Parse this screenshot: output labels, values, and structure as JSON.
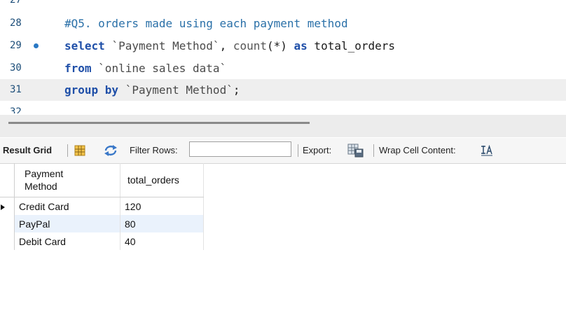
{
  "editor": {
    "lines": [
      {
        "num": "27",
        "text": ""
      },
      {
        "num": "28",
        "text": "#Q5. orders made using each payment method"
      },
      {
        "num": "29",
        "kw1": "select",
        "sp1": " ",
        "str1": "`Payment Method`",
        "sp2": ", ",
        "fn1": "count",
        "sp3": "(*) ",
        "kw2": "as",
        "sp4": " total_orders"
      },
      {
        "num": "30",
        "kw1": "from",
        "sp1": " ",
        "str1": "`online sales data`"
      },
      {
        "num": "31",
        "kw1": "group by",
        "sp1": " ",
        "str1": "`Payment Method`",
        "sp2": ";"
      },
      {
        "num": "32",
        "text": ""
      }
    ]
  },
  "toolbar": {
    "result_grid_label": "Result Grid",
    "filter_rows_label": "Filter Rows:",
    "filter_value": "",
    "export_label": "Export:",
    "wrap_label": "Wrap Cell Content:"
  },
  "grid": {
    "headers": [
      "Payment\nMethod",
      "total_orders"
    ],
    "rows": [
      [
        "Credit Card",
        "120"
      ],
      [
        "PayPal",
        "80"
      ],
      [
        "Debit Card",
        "40"
      ]
    ]
  }
}
